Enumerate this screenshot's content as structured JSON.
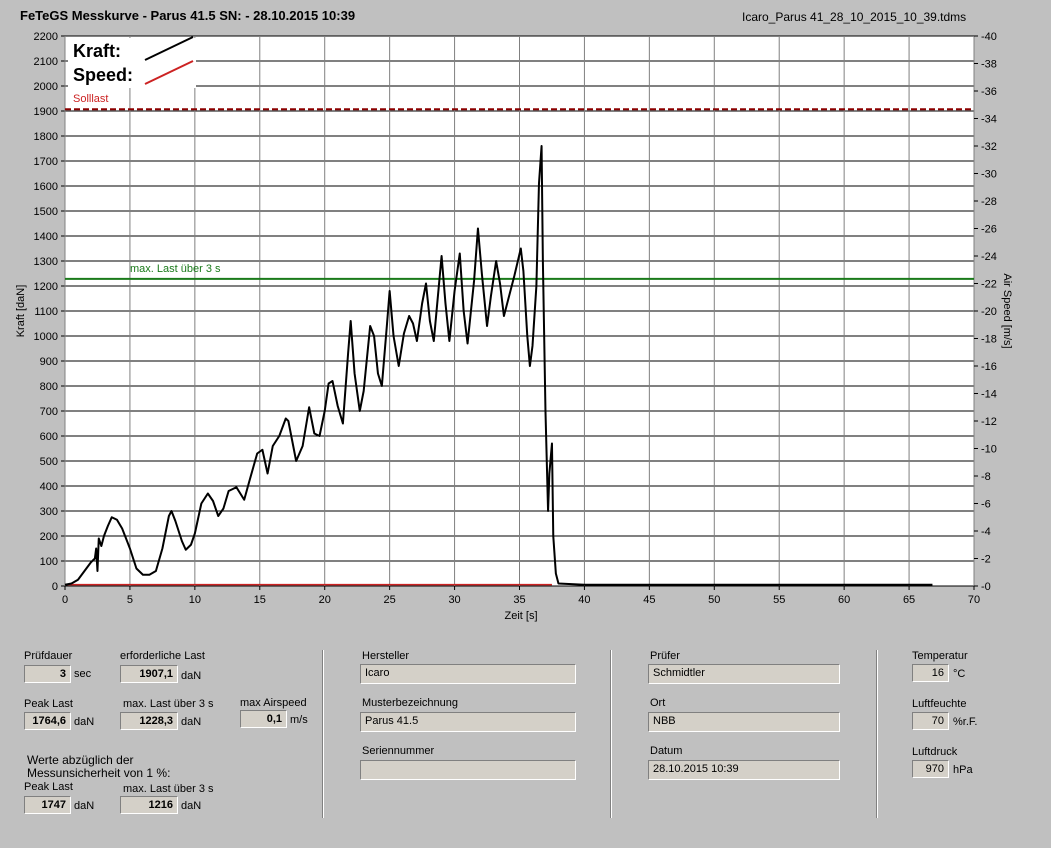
{
  "header": {
    "title": "FeTeGS Messkurve - Parus 41.5  SN:  - 28.10.2015 10:39",
    "file": "Icaro_Parus 41_28_10_2015_10_39.tdms"
  },
  "colors": {
    "kraft": "#000000",
    "speed": "#cc2222",
    "sollast": "#8b0000",
    "maxlast": "#1a7a1a",
    "plot_bg": "#ffffff",
    "panel_bg": "#c0c0c0"
  },
  "chart_data": {
    "type": "line",
    "legend": {
      "kraft": "Kraft:",
      "speed": "Speed:"
    },
    "xlabel": "Zeit [s]",
    "ylabel_left": "Kraft [daN]",
    "ylabel_right": "Air Speed [m/s]",
    "xlim": [
      0,
      70
    ],
    "ylim_left": [
      0,
      2200
    ],
    "ylim_right": [
      0,
      40
    ],
    "x_ticks": [
      "0",
      "5",
      "10",
      "15",
      "20",
      "25",
      "30",
      "35",
      "40",
      "45",
      "50",
      "55",
      "60",
      "65",
      "70"
    ],
    "y_ticks_left": [
      "0",
      "100",
      "200",
      "300",
      "400",
      "500",
      "600",
      "700",
      "800",
      "900",
      "1000",
      "1100",
      "1200",
      "1300",
      "1400",
      "1500",
      "1600",
      "1700",
      "1800",
      "1900",
      "2000",
      "2100",
      "2200"
    ],
    "y_ticks_right": [
      "0",
      "2",
      "4",
      "6",
      "8",
      "10",
      "12",
      "14",
      "16",
      "18",
      "20",
      "22",
      "24",
      "26",
      "28",
      "30",
      "32",
      "34",
      "36",
      "38",
      "40"
    ],
    "reference_lines": [
      {
        "label": "Solllast",
        "value": 1907.1,
        "style": "dashed"
      },
      {
        "label": "max. Last über  3 s",
        "value": 1228.3,
        "style": "solid"
      }
    ],
    "series": [
      {
        "name": "Kraft",
        "points": [
          [
            0,
            5
          ],
          [
            0.5,
            10
          ],
          [
            1,
            25
          ],
          [
            1.5,
            60
          ],
          [
            2,
            95
          ],
          [
            2.3,
            110
          ],
          [
            2.4,
            150
          ],
          [
            2.5,
            60
          ],
          [
            2.6,
            190
          ],
          [
            2.8,
            160
          ],
          [
            3,
            200
          ],
          [
            3.3,
            240
          ],
          [
            3.6,
            275
          ],
          [
            4,
            265
          ],
          [
            4.4,
            230
          ],
          [
            5,
            150
          ],
          [
            5.5,
            70
          ],
          [
            6,
            45
          ],
          [
            6.5,
            45
          ],
          [
            7,
            60
          ],
          [
            7.5,
            150
          ],
          [
            8,
            280
          ],
          [
            8.2,
            300
          ],
          [
            8.5,
            260
          ],
          [
            9,
            180
          ],
          [
            9.3,
            145
          ],
          [
            9.7,
            165
          ],
          [
            10,
            210
          ],
          [
            10.5,
            330
          ],
          [
            11,
            370
          ],
          [
            11.4,
            340
          ],
          [
            11.8,
            280
          ],
          [
            12.2,
            310
          ],
          [
            12.6,
            380
          ],
          [
            13.2,
            395
          ],
          [
            13.8,
            345
          ],
          [
            14.2,
            420
          ],
          [
            14.8,
            530
          ],
          [
            15.2,
            545
          ],
          [
            15.6,
            450
          ],
          [
            16,
            560
          ],
          [
            16.5,
            600
          ],
          [
            17,
            670
          ],
          [
            17.2,
            660
          ],
          [
            17.8,
            500
          ],
          [
            18.3,
            560
          ],
          [
            18.8,
            715
          ],
          [
            19.2,
            610
          ],
          [
            19.6,
            600
          ],
          [
            20,
            700
          ],
          [
            20.3,
            810
          ],
          [
            20.6,
            820
          ],
          [
            21,
            720
          ],
          [
            21.4,
            650
          ],
          [
            21.8,
            930
          ],
          [
            22,
            1060
          ],
          [
            22.3,
            850
          ],
          [
            22.7,
            700
          ],
          [
            23,
            780
          ],
          [
            23.5,
            1040
          ],
          [
            23.8,
            1000
          ],
          [
            24.1,
            850
          ],
          [
            24.4,
            800
          ],
          [
            24.8,
            1050
          ],
          [
            25,
            1180
          ],
          [
            25.3,
            1000
          ],
          [
            25.7,
            880
          ],
          [
            26.1,
            1010
          ],
          [
            26.5,
            1080
          ],
          [
            26.8,
            1050
          ],
          [
            27.1,
            980
          ],
          [
            27.5,
            1130
          ],
          [
            27.8,
            1210
          ],
          [
            28.1,
            1060
          ],
          [
            28.4,
            980
          ],
          [
            28.7,
            1150
          ],
          [
            29,
            1320
          ],
          [
            29.3,
            1130
          ],
          [
            29.6,
            980
          ],
          [
            30,
            1180
          ],
          [
            30.4,
            1330
          ],
          [
            30.7,
            1100
          ],
          [
            31,
            970
          ],
          [
            31.5,
            1220
          ],
          [
            31.8,
            1430
          ],
          [
            32.1,
            1250
          ],
          [
            32.5,
            1040
          ],
          [
            32.8,
            1160
          ],
          [
            33.2,
            1300
          ],
          [
            33.5,
            1210
          ],
          [
            33.8,
            1080
          ],
          [
            34.2,
            1160
          ],
          [
            34.6,
            1240
          ],
          [
            35.1,
            1350
          ],
          [
            35.3,
            1260
          ],
          [
            35.6,
            1000
          ],
          [
            35.8,
            880
          ],
          [
            36,
            960
          ],
          [
            36.3,
            1200
          ],
          [
            36.5,
            1610
          ],
          [
            36.7,
            1760
          ],
          [
            36.8,
            1300
          ],
          [
            37,
            700
          ],
          [
            37.2,
            300
          ],
          [
            37.3,
            450
          ],
          [
            37.5,
            570
          ],
          [
            37.6,
            200
          ],
          [
            37.8,
            50
          ],
          [
            38,
            10
          ],
          [
            40,
            5
          ],
          [
            50,
            5
          ],
          [
            60,
            5
          ],
          [
            66.8,
            5
          ]
        ]
      },
      {
        "name": "Speed",
        "points": [
          [
            0,
            0.1
          ],
          [
            37.5,
            0.1
          ]
        ]
      }
    ]
  },
  "panel": {
    "pruefdauer": {
      "label": "Prüfdauer",
      "value": "3",
      "unit": "sec"
    },
    "erforderliche_last": {
      "label": "erforderliche Last",
      "value": "1907,1",
      "unit": "daN"
    },
    "peak_last": {
      "label": "Peak Last",
      "value": "1764,6",
      "unit": "daN"
    },
    "max_last_3s": {
      "label": "max. Last über  3 s",
      "value": "1228,3",
      "unit": "daN"
    },
    "max_airspeed": {
      "label": "max Airspeed",
      "value": "0,1",
      "unit": "m/s"
    },
    "werte_note": "Werte abzüglich der\nMessunsicherheit von 1  %:",
    "peak_last_2": {
      "label": "Peak Last",
      "value": "1747",
      "unit": "daN"
    },
    "max_last_3s_2": {
      "label": "max. Last über  3 s",
      "value": "1216",
      "unit": "daN"
    },
    "hersteller": {
      "label": "Hersteller",
      "value": "Icaro"
    },
    "musterbezeichnung": {
      "label": "Musterbezeichnung",
      "value": "Parus 41.5"
    },
    "seriennummer": {
      "label": "Seriennummer",
      "value": ""
    },
    "pruefer": {
      "label": "Prüfer",
      "value": "Schmidtler"
    },
    "ort": {
      "label": "Ort",
      "value": "NBB"
    },
    "datum": {
      "label": "Datum",
      "value": "28.10.2015 10:39"
    },
    "temperatur": {
      "label": "Temperatur",
      "value": "16",
      "unit": "°C"
    },
    "luftfeuchte": {
      "label": "Luftfeuchte",
      "value": "70",
      "unit": "%r.F."
    },
    "luftdruck": {
      "label": "Luftdruck",
      "value": "970",
      "unit": "hPa"
    }
  }
}
